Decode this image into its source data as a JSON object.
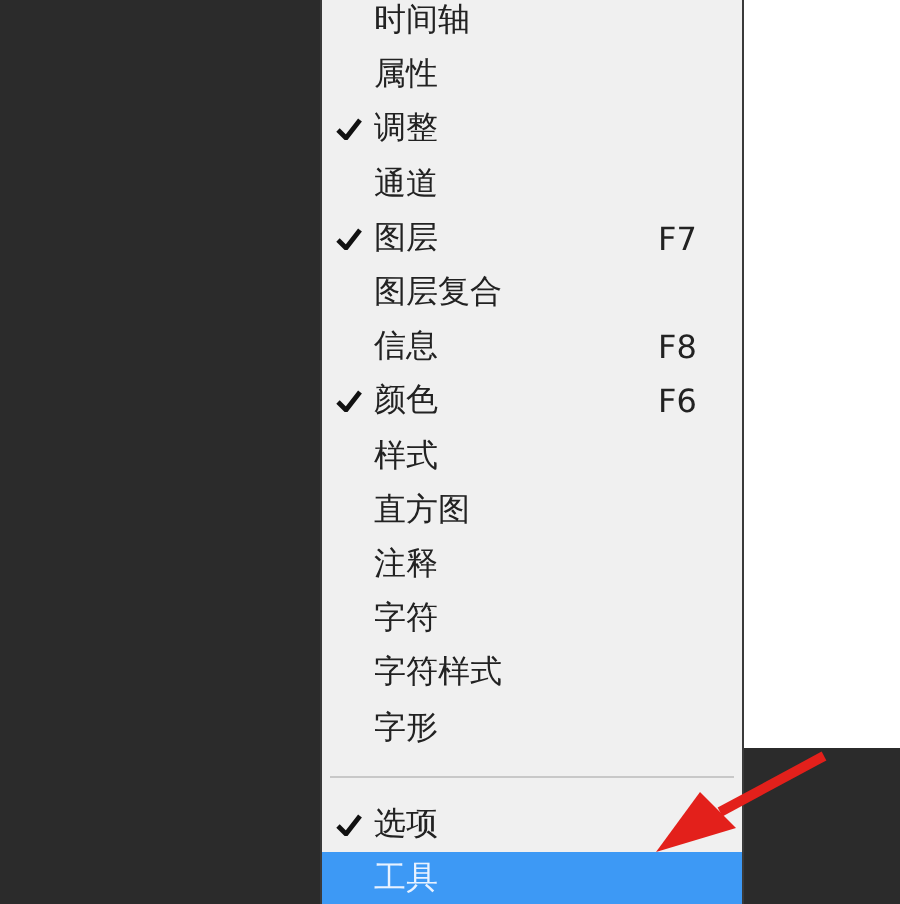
{
  "menu": {
    "items": [
      {
        "kind": "item",
        "label": "时间轴",
        "checked": false,
        "selected": false
      },
      {
        "kind": "item",
        "label": "属性",
        "checked": false,
        "selected": false
      },
      {
        "kind": "item",
        "label": "调整",
        "checked": true,
        "selected": false
      },
      {
        "kind": "item",
        "label": "通道",
        "checked": false,
        "selected": false
      },
      {
        "kind": "item",
        "label": "图层",
        "checked": true,
        "shortcut": "F7",
        "selected": false
      },
      {
        "kind": "item",
        "label": "图层复合",
        "checked": false,
        "selected": false
      },
      {
        "kind": "item",
        "label": "信息",
        "checked": false,
        "shortcut": "F8",
        "selected": false
      },
      {
        "kind": "item",
        "label": "颜色",
        "checked": true,
        "shortcut": "F6",
        "selected": false
      },
      {
        "kind": "item",
        "label": "样式",
        "checked": false,
        "selected": false
      },
      {
        "kind": "item",
        "label": "直方图",
        "checked": false,
        "selected": false
      },
      {
        "kind": "item",
        "label": "注释",
        "checked": false,
        "selected": false
      },
      {
        "kind": "item",
        "label": "字符",
        "checked": false,
        "selected": false
      },
      {
        "kind": "item",
        "label": "字符样式",
        "checked": false,
        "selected": false
      },
      {
        "kind": "item",
        "label": "字形",
        "checked": false,
        "selected": false
      },
      {
        "kind": "separator"
      },
      {
        "kind": "item",
        "label": "选项",
        "checked": true,
        "selected": false
      },
      {
        "kind": "item",
        "label": "工具",
        "checked": false,
        "selected": true
      }
    ]
  }
}
